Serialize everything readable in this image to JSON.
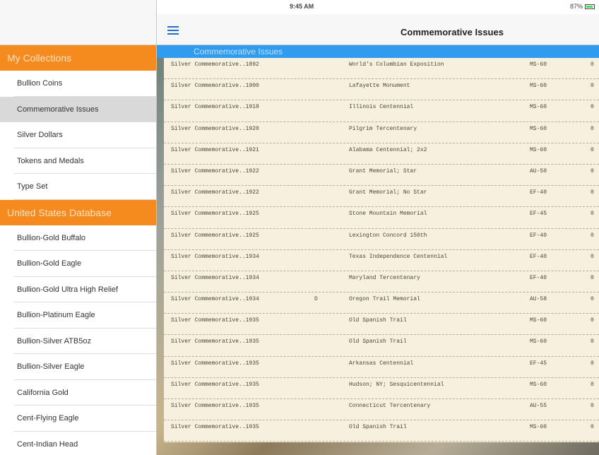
{
  "status": {
    "device": "iPad",
    "time": "9:45 AM",
    "battery": "87%"
  },
  "sidebar": {
    "sections": [
      {
        "title": "My Collections",
        "items": [
          {
            "label": "Bullion Coins",
            "selected": false
          },
          {
            "label": "Commemorative Issues",
            "selected": true
          },
          {
            "label": "Silver Dollars",
            "selected": false
          },
          {
            "label": "Tokens and Medals",
            "selected": false
          },
          {
            "label": "Type Set",
            "selected": false
          }
        ]
      },
      {
        "title": "United States Database",
        "items": [
          {
            "label": "Bullion-Gold Buffalo",
            "selected": false
          },
          {
            "label": "Bullion-Gold Eagle",
            "selected": false
          },
          {
            "label": "Bullion-Gold Ultra High Relief",
            "selected": false
          },
          {
            "label": "Bullion-Platinum Eagle",
            "selected": false
          },
          {
            "label": "Bullion-Silver ATB5oz",
            "selected": false
          },
          {
            "label": "Bullion-Silver Eagle",
            "selected": false
          },
          {
            "label": "California Gold",
            "selected": false
          },
          {
            "label": "Cent-Flying Eagle",
            "selected": false
          },
          {
            "label": "Cent-Indian Head",
            "selected": false
          }
        ]
      }
    ]
  },
  "navbar": {
    "title": "Commemorative Issues",
    "menu_icon": "hamburger-menu-icon"
  },
  "list": {
    "header": "Commemorative Issues",
    "rows": [
      {
        "series": "Silver Commemorative..1892",
        "mint": "",
        "description": "World's Columbian Exposition",
        "grade": "MS-60",
        "qty": "0"
      },
      {
        "series": "Silver Commemorative..1900",
        "mint": "",
        "description": "Lafayette Monument",
        "grade": "MS-60",
        "qty": "0"
      },
      {
        "series": "Silver Commemorative..1918",
        "mint": "",
        "description": "Illinois Centennial",
        "grade": "MS-60",
        "qty": "0"
      },
      {
        "series": "Silver Commemorative..1920",
        "mint": "",
        "description": "Pilgrim Tercentenary",
        "grade": "MS-60",
        "qty": "0"
      },
      {
        "series": "Silver Commemorative..1921",
        "mint": "",
        "description": "Alabama Centennial; 2x2",
        "grade": "MS-60",
        "qty": "0"
      },
      {
        "series": "Silver Commemorative..1922",
        "mint": "",
        "description": "Grant Memorial; Star",
        "grade": "AU-50",
        "qty": "0"
      },
      {
        "series": "Silver Commemorative..1922",
        "mint": "",
        "description": "Grant Memorial; No Star",
        "grade": "EF-40",
        "qty": "0"
      },
      {
        "series": "Silver Commemorative..1925",
        "mint": "",
        "description": "Stone Mountain Memorial",
        "grade": "EF-45",
        "qty": "0"
      },
      {
        "series": "Silver Commemorative..1925",
        "mint": "",
        "description": "Lexington Concord 150th",
        "grade": "EF-40",
        "qty": "0"
      },
      {
        "series": "Silver Commemorative..1934",
        "mint": "",
        "description": "Texas Independence Centennial",
        "grade": "EF-40",
        "qty": "0"
      },
      {
        "series": "Silver Commemorative..1934",
        "mint": "",
        "description": "Maryland Tercentenary",
        "grade": "EF-40",
        "qty": "0"
      },
      {
        "series": "Silver Commemorative..1934",
        "mint": "D",
        "description": "Oregon Trail Memorial",
        "grade": "AU-58",
        "qty": "0"
      },
      {
        "series": "Silver Commemorative..1935",
        "mint": "",
        "description": "Old Spanish Trail",
        "grade": "MS-60",
        "qty": "0"
      },
      {
        "series": "Silver Commemorative..1935",
        "mint": "",
        "description": "Old Spanish Trail",
        "grade": "MS-60",
        "qty": "0"
      },
      {
        "series": "Silver Commemorative..1935",
        "mint": "",
        "description": "Arkansas Centennial",
        "grade": "EF-45",
        "qty": "0"
      },
      {
        "series": "Silver Commemorative..1935",
        "mint": "",
        "description": "Hudson; NY; Sesquicentennial",
        "grade": "MS-60",
        "qty": "0"
      },
      {
        "series": "Silver Commemorative..1935",
        "mint": "",
        "description": "Connecticut Tercentenary",
        "grade": "AU-55",
        "qty": "0"
      },
      {
        "series": "Silver Commemorative..1935",
        "mint": "",
        "description": "Old Spanish Trail",
        "grade": "MS-60",
        "qty": "0"
      }
    ]
  },
  "colors": {
    "accent_orange": "#f58a1f",
    "header_blue": "#2f9cf0",
    "panel_cream": "#f7f0de"
  }
}
